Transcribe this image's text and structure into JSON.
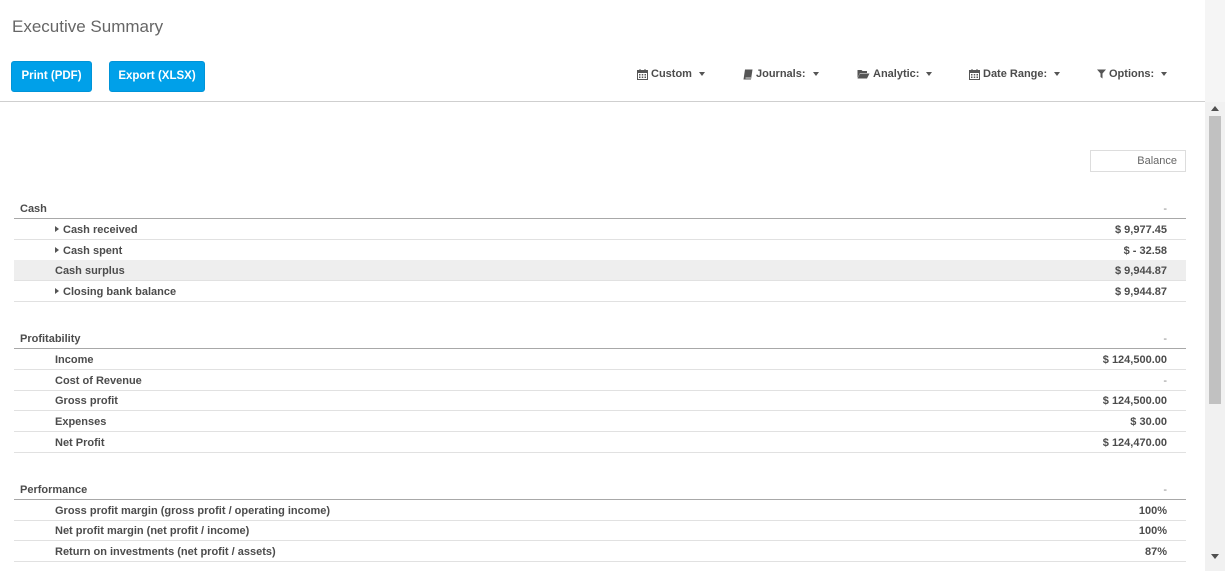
{
  "header": {
    "title": "Executive Summary",
    "print_label": "Print (PDF)",
    "export_label": "Export (XLSX)"
  },
  "filters": {
    "custom": "Custom",
    "journals": "Journals:",
    "analytic": "Analytic:",
    "date_range": "Date Range:",
    "options": "Options:"
  },
  "report": {
    "column_header": "Balance",
    "cash": {
      "title": "Cash",
      "value": "-",
      "rows": [
        {
          "label": "Cash received",
          "value": "$ 9,977.45"
        },
        {
          "label": "Cash spent",
          "value": "$ - 32.58"
        },
        {
          "label": "Cash surplus",
          "value": "$ 9,944.87"
        },
        {
          "label": "Closing bank balance",
          "value": "$ 9,944.87"
        }
      ]
    },
    "profitability": {
      "title": "Profitability",
      "value": "-",
      "rows": [
        {
          "label": "Income",
          "value": "$ 124,500.00"
        },
        {
          "label": "Cost of Revenue",
          "value": "-"
        },
        {
          "label": "Gross profit",
          "value": "$ 124,500.00"
        },
        {
          "label": "Expenses",
          "value": "$ 30.00"
        },
        {
          "label": "Net Profit",
          "value": "$ 124,470.00"
        }
      ]
    },
    "performance": {
      "title": "Performance",
      "value": "-",
      "rows": [
        {
          "label": "Gross profit margin (gross profit / operating income)",
          "value": "100%"
        },
        {
          "label": "Net profit margin (net profit / income)",
          "value": "100%"
        },
        {
          "label": "Return on investments (net profit / assets)",
          "value": "87%"
        }
      ]
    }
  }
}
